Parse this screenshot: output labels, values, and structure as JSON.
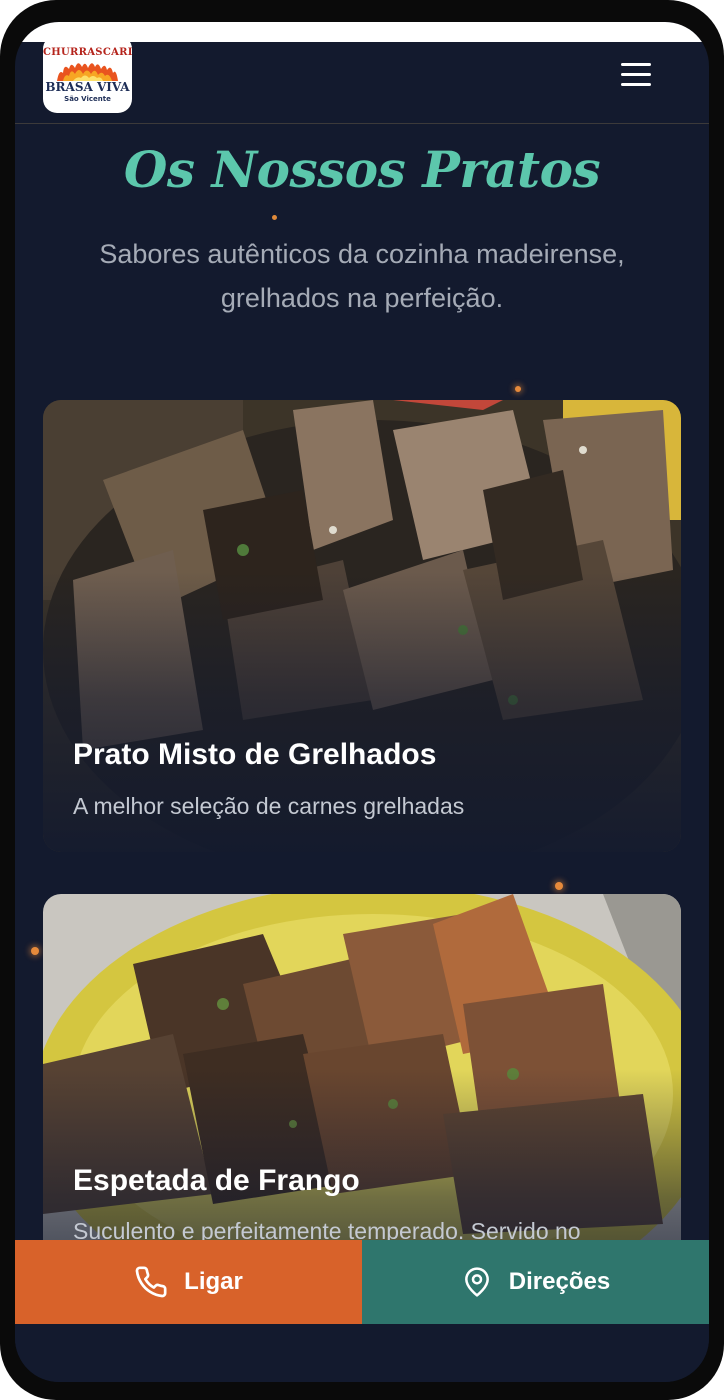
{
  "header": {
    "logo": {
      "line1": "CHURRASCARIA",
      "line2": "BRASA VIVA",
      "line3": "São Vicente"
    },
    "menu_icon": "hamburger-menu-icon"
  },
  "section": {
    "title": "Os Nossos Pratos",
    "subtitle_line1": "Sabores autênticos da cozinha madeirense,",
    "subtitle_line2": "grelhados na perfeição."
  },
  "dishes": [
    {
      "name": "Prato Misto de Grelhados",
      "description": "A melhor seleção de carnes grelhadas"
    },
    {
      "name": "Espetada de Frango",
      "description": "Suculento e perfeitamente temperado. Servido no"
    }
  ],
  "actions": {
    "call_label": "Ligar",
    "call_icon": "phone-icon",
    "directions_label": "Direções",
    "directions_icon": "map-pin-icon"
  },
  "colors": {
    "background": "#131a2e",
    "title_teal": "#5cc7ac",
    "call_orange": "#d8622a",
    "directions_teal": "#2f766d",
    "ember": "#e68a3b"
  }
}
